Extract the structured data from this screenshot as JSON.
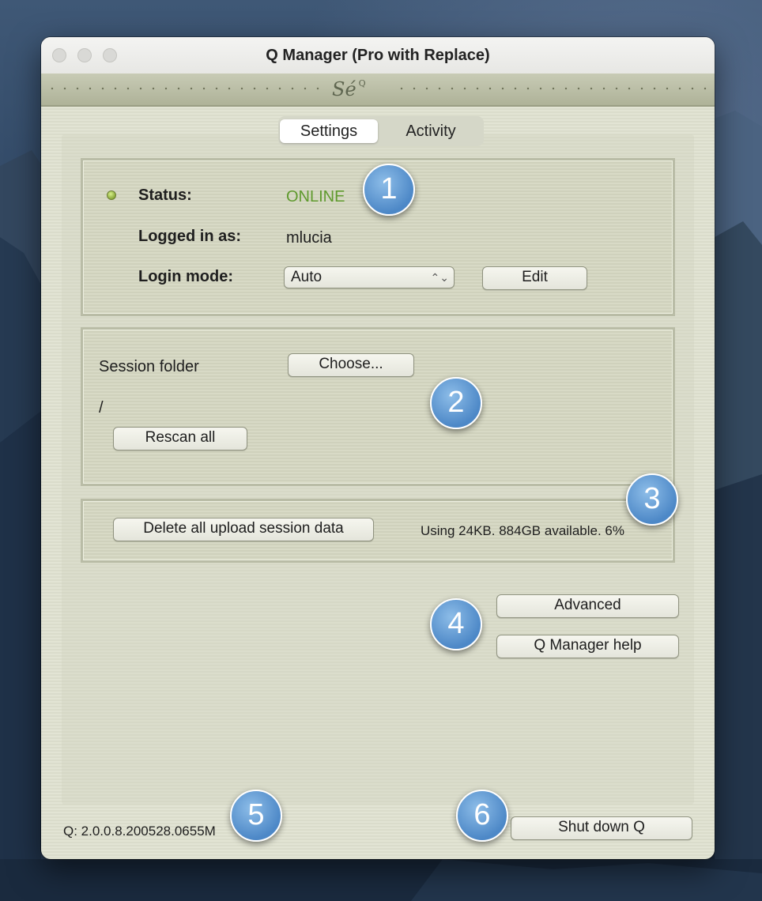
{
  "window": {
    "title": "Q Manager (Pro with Replace)",
    "brand_logo": "Sé",
    "brand_logo_sup": "Q"
  },
  "tabs": [
    {
      "label": "Settings",
      "active": true
    },
    {
      "label": "Activity",
      "active": false
    }
  ],
  "status_panel": {
    "status_label": "Status:",
    "status_value": "ONLINE",
    "status_color": "#5f9a2e",
    "logged_in_label": "Logged in as:",
    "logged_in_value": "mlucia",
    "login_mode_label": "Login mode:",
    "login_mode_value": "Auto",
    "edit_label": "Edit"
  },
  "session_panel": {
    "session_folder_label": "Session folder",
    "choose_label": "Choose...",
    "path": "/",
    "rescan_label": "Rescan all"
  },
  "storage_panel": {
    "delete_label": "Delete all upload session data",
    "usage_text": "Using 24KB.  884GB available. 6%"
  },
  "actions": {
    "advanced_label": "Advanced",
    "help_label": "Q Manager help",
    "shutdown_label": "Shut down Q"
  },
  "footer": {
    "version": "Q: 2.0.0.8.200528.0655M"
  },
  "callouts": [
    "1",
    "2",
    "3",
    "4",
    "5",
    "6"
  ]
}
